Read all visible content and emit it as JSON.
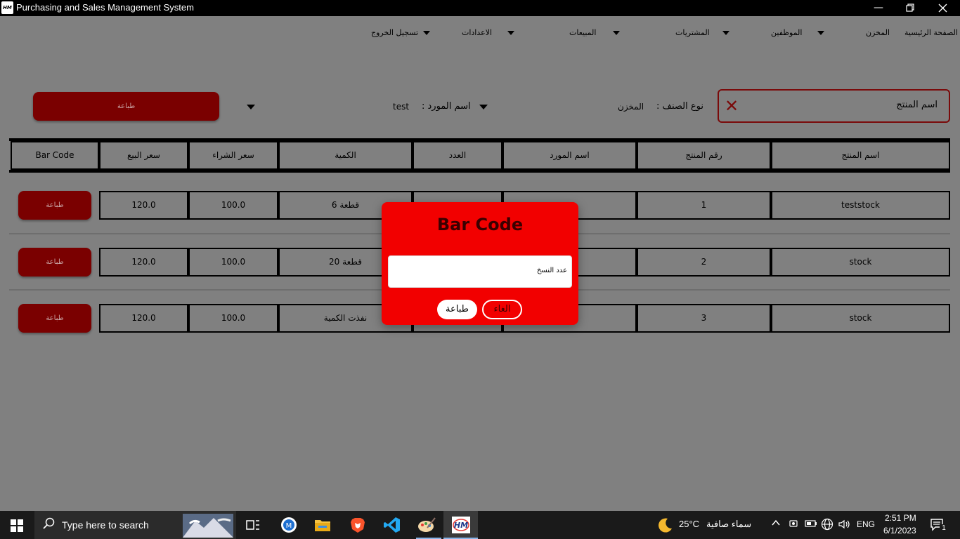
{
  "window": {
    "title": "Purchasing and Sales Management System",
    "app_icon_label": "HM"
  },
  "menu": {
    "items": [
      {
        "label": "الصفحة الرئيسية"
      },
      {
        "label": "المخزن"
      },
      {
        "label": "الموظفين"
      },
      {
        "label": "المشتريات"
      },
      {
        "label": "المبيعات"
      },
      {
        "label": "الاعدادات"
      },
      {
        "label": "تسجيل الخروج"
      }
    ]
  },
  "filters": {
    "search_placeholder": "اسم المنتج",
    "category_label": "نوع الصنف :",
    "category_value": "المخزن",
    "supplier_label": "اسم المورد :",
    "supplier_value": "test",
    "print_label": "طباعة"
  },
  "table": {
    "headers": [
      "اسم المنتج",
      "رقم المنتج",
      "اسم المورد",
      "العدد",
      "الكمية",
      "سعر الشراء",
      "سعر البيع",
      "Bar Code"
    ],
    "rows": [
      {
        "name": "teststock",
        "number": "1",
        "supplier": "",
        "count": "",
        "quantity": "6 قطعة",
        "buy": "100.0",
        "sell": "120.0",
        "action": "طباعة"
      },
      {
        "name": "stock",
        "number": "2",
        "supplier": "",
        "count": "",
        "quantity": "20 قطعة",
        "buy": "100.0",
        "sell": "120.0",
        "action": "طباعة"
      },
      {
        "name": "stock",
        "number": "3",
        "supplier": "",
        "count": "",
        "quantity": "نفذت الكمية",
        "buy": "100.0",
        "sell": "120.0",
        "action": "طباعة"
      }
    ]
  },
  "dialog": {
    "title": "Bar Code",
    "copies_placeholder": "عدد النسخ",
    "print_label": "طباعة",
    "cancel_label": "الغاء"
  },
  "taskbar": {
    "search_text": "Type here to search",
    "temperature": "25°C",
    "weather": "سماء صافية",
    "language": "ENG",
    "time": "2:51 PM",
    "date": "6/1/2023",
    "notifications": "1"
  },
  "colors": {
    "overlay_bg": "#808080",
    "dark_red": "#7a0000",
    "dialog_red": "#f20000"
  }
}
